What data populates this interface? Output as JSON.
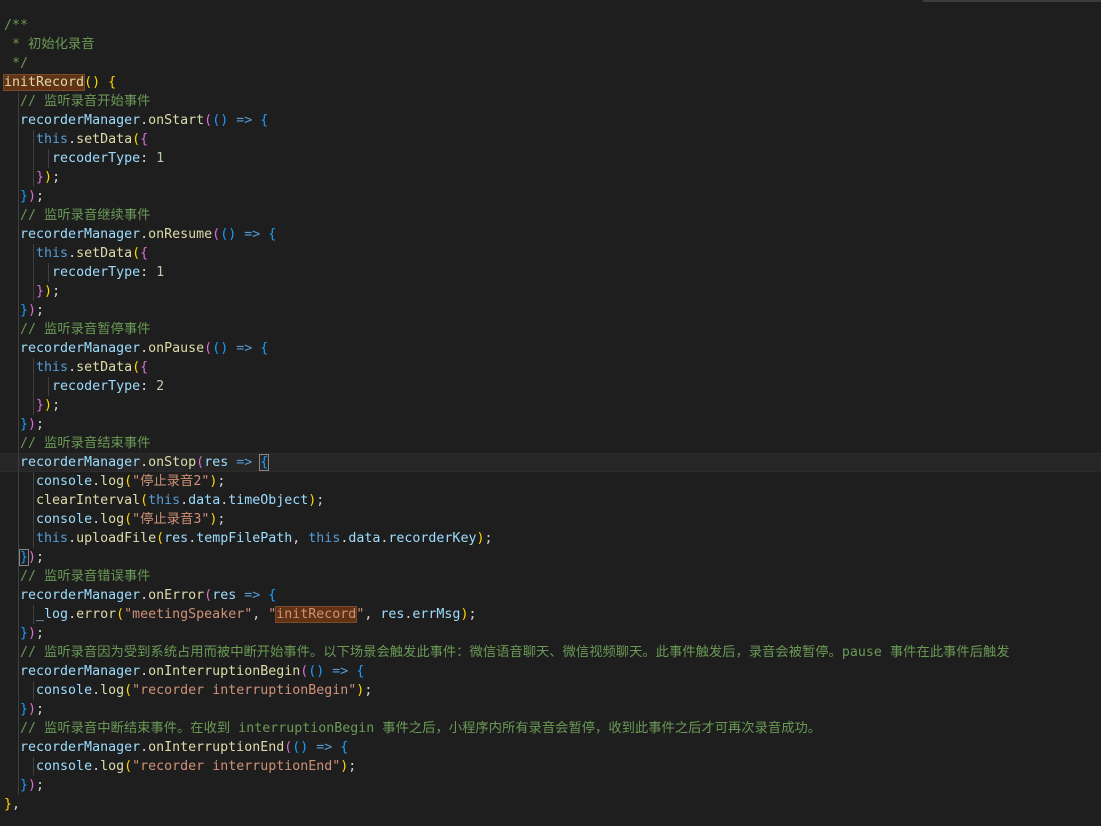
{
  "editor": {
    "lines": [
      [
        [
          "cm",
          "/**"
        ]
      ],
      [
        [
          "cm",
          " * 初始化录音"
        ]
      ],
      [
        [
          "cm",
          " */"
        ]
      ],
      [
        [
          "fn hl",
          "initRecord"
        ],
        [
          "b1",
          "()"
        ],
        [
          "op",
          " "
        ],
        [
          "b1",
          "{"
        ]
      ],
      [
        [
          "op",
          "  "
        ],
        [
          "cm",
          "// 监听录音开始事件"
        ]
      ],
      [
        [
          "op",
          "  "
        ],
        [
          "var",
          "recorderManager"
        ],
        [
          "op",
          "."
        ],
        [
          "fn",
          "onStart"
        ],
        [
          "b2",
          "("
        ],
        [
          "b3",
          "()"
        ],
        [
          "op",
          " "
        ],
        [
          "kw",
          "=>"
        ],
        [
          "op",
          " "
        ],
        [
          "b3",
          "{"
        ]
      ],
      [
        [
          "op",
          "    "
        ],
        [
          "kw",
          "this"
        ],
        [
          "op",
          "."
        ],
        [
          "fn",
          "setData"
        ],
        [
          "b1",
          "("
        ],
        [
          "b2",
          "{"
        ]
      ],
      [
        [
          "op",
          "      "
        ],
        [
          "var",
          "recoderType"
        ],
        [
          "op",
          ": "
        ],
        [
          "num",
          "1"
        ]
      ],
      [
        [
          "op",
          "    "
        ],
        [
          "b2",
          "}"
        ],
        [
          "b1",
          ")"
        ],
        [
          "op",
          ";"
        ]
      ],
      [
        [
          "op",
          "  "
        ],
        [
          "b3",
          "}"
        ],
        [
          "b2",
          ")"
        ],
        [
          "op",
          ";"
        ]
      ],
      [
        [
          "op",
          "  "
        ],
        [
          "cm",
          "// 监听录音继续事件"
        ]
      ],
      [
        [
          "op",
          "  "
        ],
        [
          "var",
          "recorderManager"
        ],
        [
          "op",
          "."
        ],
        [
          "fn",
          "onResume"
        ],
        [
          "b2",
          "("
        ],
        [
          "b3",
          "()"
        ],
        [
          "op",
          " "
        ],
        [
          "kw",
          "=>"
        ],
        [
          "op",
          " "
        ],
        [
          "b3",
          "{"
        ]
      ],
      [
        [
          "op",
          "    "
        ],
        [
          "kw",
          "this"
        ],
        [
          "op",
          "."
        ],
        [
          "fn",
          "setData"
        ],
        [
          "b1",
          "("
        ],
        [
          "b2",
          "{"
        ]
      ],
      [
        [
          "op",
          "      "
        ],
        [
          "var",
          "recoderType"
        ],
        [
          "op",
          ": "
        ],
        [
          "num",
          "1"
        ]
      ],
      [
        [
          "op",
          "    "
        ],
        [
          "b2",
          "}"
        ],
        [
          "b1",
          ")"
        ],
        [
          "op",
          ";"
        ]
      ],
      [
        [
          "op",
          "  "
        ],
        [
          "b3",
          "}"
        ],
        [
          "b2",
          ")"
        ],
        [
          "op",
          ";"
        ]
      ],
      [
        [
          "op",
          "  "
        ],
        [
          "cm",
          "// 监听录音暂停事件"
        ]
      ],
      [
        [
          "op",
          "  "
        ],
        [
          "var",
          "recorderManager"
        ],
        [
          "op",
          "."
        ],
        [
          "fn",
          "onPause"
        ],
        [
          "b2",
          "("
        ],
        [
          "b3",
          "()"
        ],
        [
          "op",
          " "
        ],
        [
          "kw",
          "=>"
        ],
        [
          "op",
          " "
        ],
        [
          "b3",
          "{"
        ]
      ],
      [
        [
          "op",
          "    "
        ],
        [
          "kw",
          "this"
        ],
        [
          "op",
          "."
        ],
        [
          "fn",
          "setData"
        ],
        [
          "b1",
          "("
        ],
        [
          "b2",
          "{"
        ]
      ],
      [
        [
          "op",
          "      "
        ],
        [
          "var",
          "recoderType"
        ],
        [
          "op",
          ": "
        ],
        [
          "num",
          "2"
        ]
      ],
      [
        [
          "op",
          "    "
        ],
        [
          "b2",
          "}"
        ],
        [
          "b1",
          ")"
        ],
        [
          "op",
          ";"
        ]
      ],
      [
        [
          "op",
          "  "
        ],
        [
          "b3",
          "}"
        ],
        [
          "b2",
          ")"
        ],
        [
          "op",
          ";"
        ]
      ],
      [
        [
          "op",
          "  "
        ],
        [
          "cm",
          "// 监听录音结束事件"
        ]
      ],
      [
        [
          "op",
          "  "
        ],
        [
          "var",
          "recorderManager"
        ],
        [
          "op",
          "."
        ],
        [
          "fn",
          "onStop"
        ],
        [
          "b2",
          "("
        ],
        [
          "var",
          "res"
        ],
        [
          "op",
          " "
        ],
        [
          "kw",
          "=>"
        ],
        [
          "op",
          " "
        ],
        [
          "b3 bm",
          "{"
        ]
      ],
      [
        [
          "op",
          "    "
        ],
        [
          "var",
          "console"
        ],
        [
          "op",
          "."
        ],
        [
          "fn",
          "log"
        ],
        [
          "b1",
          "("
        ],
        [
          "str",
          "\"停止录音2\""
        ],
        [
          "b1",
          ")"
        ],
        [
          "op",
          ";"
        ]
      ],
      [
        [
          "op",
          "    "
        ],
        [
          "fn",
          "clearInterval"
        ],
        [
          "b1",
          "("
        ],
        [
          "kw",
          "this"
        ],
        [
          "op",
          "."
        ],
        [
          "var",
          "data"
        ],
        [
          "op",
          "."
        ],
        [
          "var",
          "timeObject"
        ],
        [
          "b1",
          ")"
        ],
        [
          "op",
          ";"
        ]
      ],
      [
        [
          "op",
          "    "
        ],
        [
          "var",
          "console"
        ],
        [
          "op",
          "."
        ],
        [
          "fn",
          "log"
        ],
        [
          "b1",
          "("
        ],
        [
          "str",
          "\"停止录音3\""
        ],
        [
          "b1",
          ")"
        ],
        [
          "op",
          ";"
        ]
      ],
      [
        [
          "op",
          "    "
        ],
        [
          "kw",
          "this"
        ],
        [
          "op",
          "."
        ],
        [
          "fn",
          "uploadFile"
        ],
        [
          "b1",
          "("
        ],
        [
          "var",
          "res"
        ],
        [
          "op",
          "."
        ],
        [
          "var",
          "tempFilePath"
        ],
        [
          "op",
          ", "
        ],
        [
          "kw",
          "this"
        ],
        [
          "op",
          "."
        ],
        [
          "var",
          "data"
        ],
        [
          "op",
          "."
        ],
        [
          "var",
          "recorderKey"
        ],
        [
          "b1",
          ")"
        ],
        [
          "op",
          ";"
        ]
      ],
      [
        [
          "op",
          "  "
        ],
        [
          "b3 bm",
          "}"
        ],
        [
          "b2",
          ")"
        ],
        [
          "op",
          ";"
        ]
      ],
      [
        [
          "op",
          "  "
        ],
        [
          "cm",
          "// 监听录音错误事件"
        ]
      ],
      [
        [
          "op",
          "  "
        ],
        [
          "var",
          "recorderManager"
        ],
        [
          "op",
          "."
        ],
        [
          "fn",
          "onError"
        ],
        [
          "b2",
          "("
        ],
        [
          "var",
          "res"
        ],
        [
          "op",
          " "
        ],
        [
          "kw",
          "=>"
        ],
        [
          "op",
          " "
        ],
        [
          "b3",
          "{"
        ]
      ],
      [
        [
          "op",
          "    "
        ],
        [
          "var",
          "_log"
        ],
        [
          "op",
          "."
        ],
        [
          "fn",
          "error"
        ],
        [
          "b1",
          "("
        ],
        [
          "str",
          "\"meetingSpeaker\""
        ],
        [
          "op",
          ", "
        ],
        [
          "str",
          "\""
        ],
        [
          "str hl",
          "initRecord"
        ],
        [
          "str",
          "\""
        ],
        [
          "op",
          ", "
        ],
        [
          "var",
          "res"
        ],
        [
          "op",
          "."
        ],
        [
          "var",
          "errMsg"
        ],
        [
          "b1",
          ")"
        ],
        [
          "op",
          ";"
        ]
      ],
      [
        [
          "op",
          "  "
        ],
        [
          "b3",
          "}"
        ],
        [
          "b2",
          ")"
        ],
        [
          "op",
          ";"
        ]
      ],
      [
        [
          "op",
          "  "
        ],
        [
          "cm",
          "// 监听录音因为受到系统占用而被中断开始事件。以下场景会触发此事件：微信语音聊天、微信视频聊天。此事件触发后，录音会被暂停。pause 事件在此事件后触发"
        ]
      ],
      [
        [
          "op",
          "  "
        ],
        [
          "var",
          "recorderManager"
        ],
        [
          "op",
          "."
        ],
        [
          "fn",
          "onInterruptionBegin"
        ],
        [
          "b2",
          "("
        ],
        [
          "b3",
          "()"
        ],
        [
          "op",
          " "
        ],
        [
          "kw",
          "=>"
        ],
        [
          "op",
          " "
        ],
        [
          "b3",
          "{"
        ]
      ],
      [
        [
          "op",
          "    "
        ],
        [
          "var",
          "console"
        ],
        [
          "op",
          "."
        ],
        [
          "fn",
          "log"
        ],
        [
          "b1",
          "("
        ],
        [
          "str",
          "\"recorder interruptionBegin\""
        ],
        [
          "b1",
          ")"
        ],
        [
          "op",
          ";"
        ]
      ],
      [
        [
          "op",
          "  "
        ],
        [
          "b3",
          "}"
        ],
        [
          "b2",
          ")"
        ],
        [
          "op",
          ";"
        ]
      ],
      [
        [
          "op",
          "  "
        ],
        [
          "cm",
          "// 监听录音中断结束事件。在收到 interruptionBegin 事件之后，小程序内所有录音会暂停，收到此事件之后才可再次录音成功。"
        ]
      ],
      [
        [
          "op",
          "  "
        ],
        [
          "var",
          "recorderManager"
        ],
        [
          "op",
          "."
        ],
        [
          "fn",
          "onInterruptionEnd"
        ],
        [
          "b2",
          "("
        ],
        [
          "b3",
          "()"
        ],
        [
          "op",
          " "
        ],
        [
          "kw",
          "=>"
        ],
        [
          "op",
          " "
        ],
        [
          "b3",
          "{"
        ]
      ],
      [
        [
          "op",
          "    "
        ],
        [
          "var",
          "console"
        ],
        [
          "op",
          "."
        ],
        [
          "fn",
          "log"
        ],
        [
          "b1",
          "("
        ],
        [
          "str",
          "\"recorder interruptionEnd\""
        ],
        [
          "b1",
          ")"
        ],
        [
          "op",
          ";"
        ]
      ],
      [
        [
          "op",
          "  "
        ],
        [
          "b3",
          "}"
        ],
        [
          "b2",
          ")"
        ],
        [
          "op",
          ";"
        ]
      ],
      [
        [
          "b1",
          "}"
        ],
        [
          "op",
          ","
        ]
      ]
    ]
  }
}
